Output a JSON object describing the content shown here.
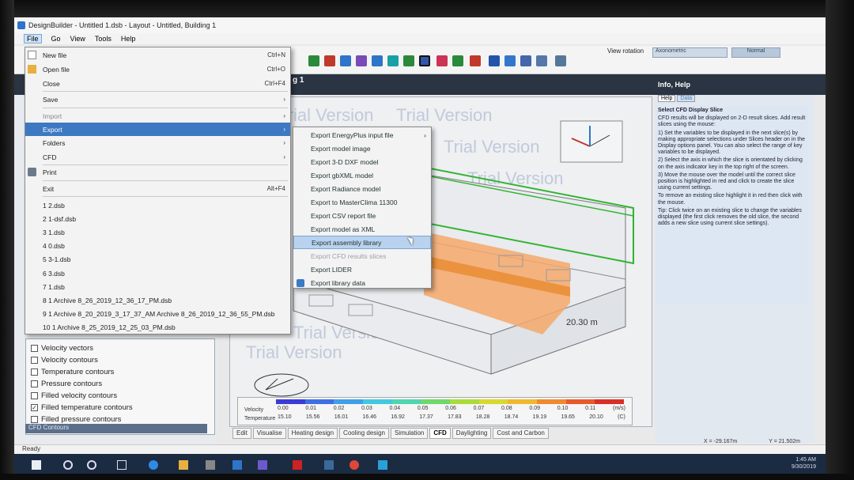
{
  "window": {
    "title": "DesignBuilder - Untitled 1.dsb - Layout - Untitled, Building 1",
    "minimize": "–",
    "maximize": "□",
    "close": "✕"
  },
  "menubar": {
    "items": [
      "File",
      "Go",
      "View",
      "Tools",
      "Help"
    ]
  },
  "toolbar": {
    "view_rotation_label": "View rotation",
    "view_rotation_value": "Axonometric",
    "normal_label": "Normal"
  },
  "navigator": {
    "tab_fragment": "g 1"
  },
  "file_menu": {
    "items": [
      {
        "label": "New file",
        "shortcut": "Ctrl+N"
      },
      {
        "label": "Open file",
        "shortcut": "Ctrl+O"
      },
      {
        "label": "Close",
        "shortcut": "Ctrl+F4"
      },
      {
        "label": "Save",
        "shortcut": "›"
      },
      {
        "label": "Import",
        "shortcut": "›"
      },
      {
        "label": "Export",
        "shortcut": "›"
      },
      {
        "label": "Folders",
        "shortcut": "›"
      },
      {
        "label": "CFD",
        "shortcut": "›"
      },
      {
        "label": "Print",
        "shortcut": ""
      },
      {
        "label": "Exit",
        "shortcut": "Alt+F4"
      }
    ],
    "recent": [
      "1 2.dsb",
      "2 1-dsf.dsb",
      "3 1.dsb",
      "4 0.dsb",
      "5 3-1.dsb",
      "6 3.dsb",
      "7 1.dsb",
      "8 1 Archive 8_26_2019_12_36_17_PM.dsb",
      "9 1 Archive 8_20_2019_3_17_37_AM Archive 8_26_2019_12_36_55_PM.dsb",
      "10 1 Archive 8_25_2019_12_25_03_PM.dsb"
    ]
  },
  "export_menu": {
    "items": [
      {
        "label": "Export EnergyPlus input file",
        "arrow": "›"
      },
      {
        "label": "Export model image",
        "arrow": ""
      },
      {
        "label": "Export 3-D DXF model",
        "arrow": ""
      },
      {
        "label": "Export gbXML model",
        "arrow": ""
      },
      {
        "label": "Export Radiance model",
        "arrow": ""
      },
      {
        "label": "Export to MasterClima 11300",
        "arrow": ""
      },
      {
        "label": "Export CSV report file",
        "arrow": ""
      },
      {
        "label": "Export model as XML",
        "arrow": ""
      },
      {
        "label": "Export assembly library",
        "arrow": ""
      },
      {
        "label": "Export CFD results slices",
        "arrow": ""
      },
      {
        "label": "Export LIDER",
        "arrow": ""
      },
      {
        "label": "Export library data",
        "arrow": ""
      }
    ]
  },
  "cfd_display": {
    "options": [
      {
        "label": "Velocity vectors",
        "checked": false
      },
      {
        "label": "Velocity contours",
        "checked": false
      },
      {
        "label": "Temperature contours",
        "checked": false
      },
      {
        "label": "Pressure contours",
        "checked": false
      },
      {
        "label": "Filled velocity contours",
        "checked": false
      },
      {
        "label": "Filled temperature contours",
        "checked": true
      },
      {
        "label": "Filled pressure contours",
        "checked": false
      }
    ],
    "footer": "CFD Contours"
  },
  "viewport": {
    "watermark": "Trial Version",
    "dimension": "20.30 m"
  },
  "legend": {
    "velocity_label": "Velocity",
    "temperature_label": "Temperature",
    "velocity_values": [
      "0.00",
      "0.01",
      "0.02",
      "0.03",
      "0.04",
      "0.05",
      "0.06",
      "0.07",
      "0.08",
      "0.09",
      "0.10",
      "0.11"
    ],
    "velocity_unit": "(m/s)",
    "temperature_values": [
      "15.10",
      "15.56",
      "16.01",
      "16.46",
      "16.92",
      "17.37",
      "17.83",
      "18.28",
      "18.74",
      "19.19",
      "19.65",
      "20.10"
    ],
    "temperature_unit": "(C)",
    "colors": [
      "#3b3bd6",
      "#3f6fe0",
      "#3fa0e8",
      "#43c8e0",
      "#4fd6b0",
      "#6ed86a",
      "#a8dc3c",
      "#d8d830",
      "#f0b830",
      "#f08a30",
      "#e85a2c",
      "#d83028"
    ]
  },
  "bottom_tabs": [
    "Edit",
    "Visualise",
    "Heating design",
    "Cooling design",
    "Simulation",
    "CFD",
    "Daylighting",
    "Cost and Carbon"
  ],
  "info_panel": {
    "title": "Info, Help",
    "tabs": [
      "Help",
      "Data"
    ],
    "heading": "Select CFD Display Slice",
    "intro": "CFD results will be displayed on 2-D result slices. Add result slices using the mouse:",
    "steps": [
      "1) Set the variables to be displayed in the next slice(s) by making appropriate selections under Slices header on in the Display options panel. You can also select the range of key variables to be displayed.",
      "2) Select the axis in which the slice is orientated by clicking on the axis indicator key in the top right of the screen.",
      "3) Move the mouse over the model until the correct slice position is highlighted in red and click to create the slice using current settings."
    ],
    "remove": "To remove an existing slice highlight it in red then click with the mouse.",
    "tip": "Tip: Click twice on an existing slice to change the variables displayed (the first click removes the old slice, the second adds a new slice using current slice settings)."
  },
  "coords": {
    "x": "X = -29.167m",
    "y": "Y = 21.502m"
  },
  "status": {
    "text": "Ready"
  },
  "taskbar": {
    "time": "1:45 AM",
    "date": "9/30/2019"
  }
}
